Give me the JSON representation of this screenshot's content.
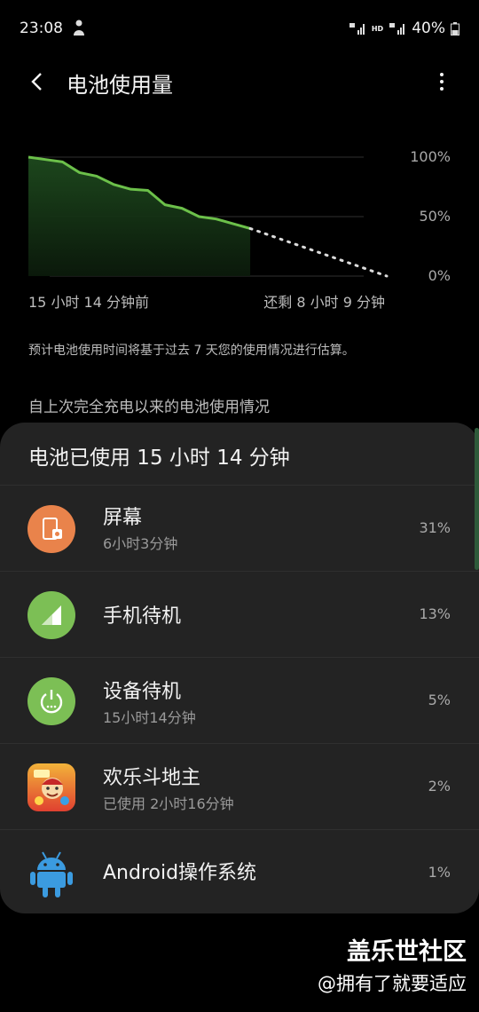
{
  "status_bar": {
    "time": "23:08",
    "battery": "40%",
    "hd_label": "HD",
    "network": "4G"
  },
  "app_bar": {
    "title": "电池使用量"
  },
  "chart_data": {
    "type": "area",
    "y_tick_labels": [
      "100%",
      "50%",
      "0%"
    ],
    "x_tick_labels": [
      "15 小时 14 分钟前",
      "还剩 8 小时 9 分钟"
    ],
    "ylim": [
      0,
      100
    ],
    "series": [
      {
        "values": [
          100,
          98,
          96,
          87,
          84,
          77,
          73,
          72,
          60,
          57,
          50,
          48,
          44,
          40
        ],
        "style": "solid",
        "color": "#6cc04a"
      },
      {
        "values": [
          40,
          0
        ],
        "style": "dotted",
        "color": "#dcdcdc"
      }
    ]
  },
  "note": "预计电池使用时间将基于过去 7 天您的使用情况进行估算。",
  "section_title": "自上次完全充电以来的电池使用情况",
  "card": {
    "header": "电池已使用 15 小时 14 分钟",
    "items": [
      {
        "name": "屏幕",
        "sub": "6小时3分钟",
        "pct": "31%",
        "icon": "screen-icon",
        "color": "#e9834b"
      },
      {
        "name": "手机待机",
        "sub": "",
        "pct": "13%",
        "icon": "cell-signal-icon",
        "color": "#7cbf55"
      },
      {
        "name": "设备待机",
        "sub": "15小时14分钟",
        "pct": "5%",
        "icon": "power-icon",
        "color": "#7cbf55"
      },
      {
        "name": "欢乐斗地主",
        "sub": "已使用 2小时16分钟",
        "pct": "2%",
        "icon": "game-app-icon",
        "color": "#e04030"
      },
      {
        "name": "Android操作系统",
        "sub": "",
        "pct": "1%",
        "icon": "android-icon",
        "color": "#3b9be0"
      }
    ]
  },
  "watermark": {
    "title": "盖乐世社区",
    "user": "@拥有了就要适应"
  }
}
